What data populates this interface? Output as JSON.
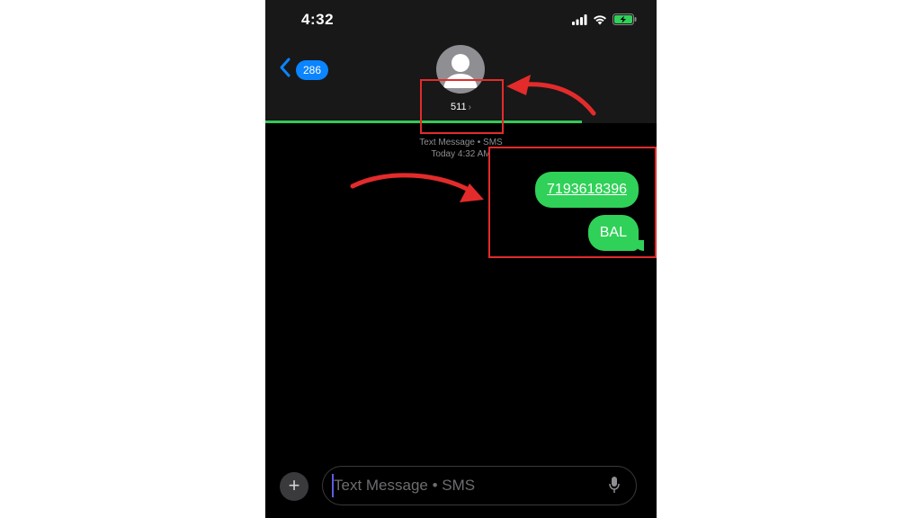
{
  "status_bar": {
    "time": "4:32",
    "icons": [
      "cellular-signal-icon",
      "wifi-icon",
      "battery-charging-icon"
    ],
    "battery_color": "#30d158"
  },
  "header": {
    "back_count": "286",
    "contact_name": "511",
    "avatar_icon": "person-silhouette-icon"
  },
  "send_progress": 0.81,
  "conversation": {
    "service_label": "Text Message • SMS",
    "timestamp": "Today 4:32 AM",
    "messages": [
      {
        "text": "7193618396",
        "sender": "me",
        "is_link": true
      },
      {
        "text": "BAL",
        "sender": "me",
        "is_link": false
      }
    ]
  },
  "composer": {
    "placeholder": "Text Message • SMS",
    "add_icon": "plus-icon",
    "mic_icon": "microphone-icon"
  },
  "colors": {
    "bubble": "#30d158",
    "accent": "#0a84ff",
    "annotation": "#e32b2b",
    "header_bg": "#181818"
  }
}
